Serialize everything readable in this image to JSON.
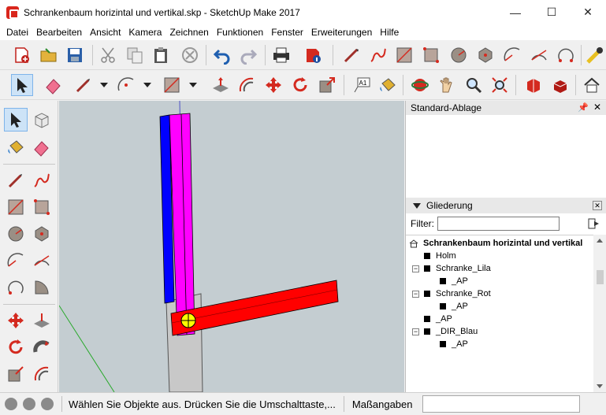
{
  "window": {
    "title": "Schrankenbaum horizintal und vertikal.skp - SketchUp Make 2017",
    "controls": {
      "minimize": "—",
      "maximize": "☐",
      "close": "✕"
    }
  },
  "menu": [
    "Datei",
    "Bearbeiten",
    "Ansicht",
    "Kamera",
    "Zeichnen",
    "Funktionen",
    "Fenster",
    "Erweiterungen",
    "Hilfe"
  ],
  "toolbar1_icons": [
    "new-model-icon",
    "open-icon",
    "save-icon",
    "cut-icon",
    "copy-icon",
    "paste-icon",
    "erase-icon",
    "undo-icon",
    "redo-icon",
    "print-icon",
    "model-info-icon",
    "line-icon",
    "freehand-icon",
    "rectangle-icon",
    "rotated-rectangle-icon",
    "circle-icon",
    "polygon-icon",
    "arc-icon",
    "arc-2pt-icon",
    "arc-3pt-icon",
    "tape-measure-icon"
  ],
  "toolbar2_icons": [
    "select-icon",
    "eraser-icon",
    "pencil-icon",
    "arc-icon",
    "rectangle-icon",
    "push-pull-icon",
    "offset-icon",
    "move-icon",
    "rotate-icon",
    "scale-icon",
    "text-icon",
    "paint-bucket-icon",
    "orbit-icon",
    "pan-icon",
    "zoom-icon",
    "zoom-extents-icon",
    "3d-warehouse-icon",
    "extension-warehouse-icon",
    "house-icon"
  ],
  "text_tool_label": "A1",
  "tray": {
    "title": "Standard-Ablage",
    "outliner": {
      "title": "Gliederung",
      "filter_label": "Filter:",
      "filter_value": "",
      "items": [
        {
          "label": "Schrankenbaum horizintal und vertikal",
          "level": 0,
          "expander": ""
        },
        {
          "label": "Holm",
          "level": 1,
          "expander": ""
        },
        {
          "label": "Schranke_Lila",
          "level": 1,
          "expander": "−"
        },
        {
          "label": "_AP",
          "level": 2,
          "expander": ""
        },
        {
          "label": "Schranke_Rot",
          "level": 1,
          "expander": "−"
        },
        {
          "label": "_AP",
          "level": 2,
          "expander": ""
        },
        {
          "label": "_AP",
          "level": 1,
          "expander": ""
        },
        {
          "label": "_DIR_Blau",
          "level": 1,
          "expander": "−"
        },
        {
          "label": "_AP",
          "level": 2,
          "expander": ""
        }
      ]
    }
  },
  "status": {
    "message": "Wählen Sie Objekte aus. Drücken Sie die Umschalttaste,...",
    "measurements_label": "Maßangaben",
    "measurements_value": ""
  },
  "colors": {
    "viewport_bg": "#c4cdd1",
    "vertical_beam": "#ff00ff",
    "blue_face": "#0000ff",
    "horizontal_beam": "#ff0000",
    "post": "#c8c8c8",
    "axis_green": "#00a000",
    "axis_blue": "#0000c0",
    "selection_yellow": "#ffff00",
    "select_highlight": "#cde3f7"
  }
}
